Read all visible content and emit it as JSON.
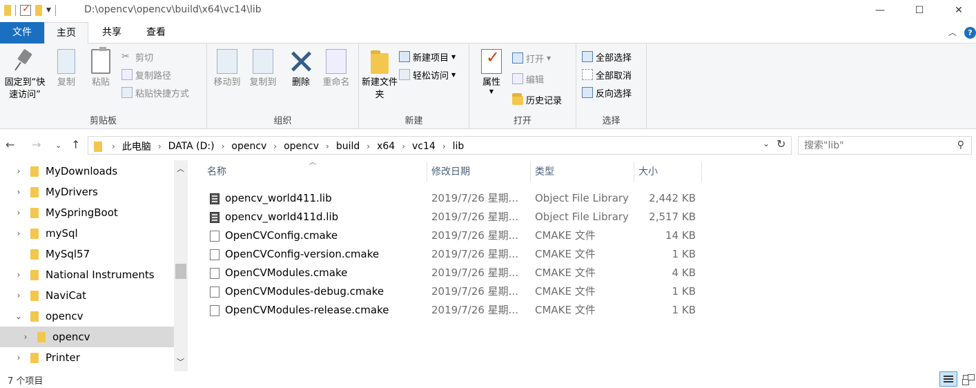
{
  "window": {
    "path": "D:\\opencv\\opencv\\build\\x64\\vc14\\lib",
    "minimize": "—",
    "maximize": "☐",
    "close": "✕"
  },
  "tabs": [
    "文件",
    "主页",
    "共享",
    "查看"
  ],
  "ribbon": {
    "clipboard": {
      "label": "剪贴板",
      "pin": "固定到“快速访问”",
      "copy": "复制",
      "paste": "粘贴",
      "cut": "剪切",
      "copy_path": "复制路径",
      "paste_shortcut": "粘贴快捷方式"
    },
    "organize": {
      "label": "组织",
      "move_to": "移动到",
      "copy_to": "复制到",
      "delete": "删除",
      "rename": "重命名"
    },
    "new": {
      "label": "新建",
      "new_folder": "新建文件夹",
      "new_item": "新建项目",
      "easy_access": "轻松访问"
    },
    "open": {
      "label": "打开",
      "properties": "属性",
      "open": "打开",
      "edit": "编辑",
      "history": "历史记录"
    },
    "select": {
      "label": "选择",
      "select_all": "全部选择",
      "select_none": "全部取消",
      "invert": "反向选择"
    }
  },
  "address": {
    "crumbs": [
      "此电脑",
      "DATA (D:)",
      "opencv",
      "opencv",
      "build",
      "x64",
      "vc14",
      "lib"
    ],
    "search_placeholder": "搜索\"lib\""
  },
  "nav": {
    "items": [
      {
        "label": "MyDownloads",
        "chevron": "›"
      },
      {
        "label": "MyDrivers",
        "chevron": "›"
      },
      {
        "label": "MySpringBoot",
        "chevron": "›"
      },
      {
        "label": "mySql",
        "chevron": "›"
      },
      {
        "label": "MySql57",
        "chevron": ""
      },
      {
        "label": "National Instruments",
        "chevron": "›"
      },
      {
        "label": "NaviCat",
        "chevron": "›"
      },
      {
        "label": "opencv",
        "chevron": "⌄"
      },
      {
        "label": "opencv",
        "chevron": "›"
      },
      {
        "label": "Printer",
        "chevron": "›"
      }
    ]
  },
  "columns": [
    "名称",
    "修改日期",
    "类型",
    "大小"
  ],
  "files": [
    {
      "name": "opencv_world411.lib",
      "date": "2019/7/26 星期...",
      "type": "Object File Library",
      "size": "2,442 KB",
      "icon": "lib"
    },
    {
      "name": "opencv_world411d.lib",
      "date": "2019/7/26 星期...",
      "type": "Object File Library",
      "size": "2,517 KB",
      "icon": "lib"
    },
    {
      "name": "OpenCVConfig.cmake",
      "date": "2019/7/26 星期...",
      "type": "CMAKE 文件",
      "size": "14 KB",
      "icon": "cmake"
    },
    {
      "name": "OpenCVConfig-version.cmake",
      "date": "2019/7/26 星期...",
      "type": "CMAKE 文件",
      "size": "1 KB",
      "icon": "cmake"
    },
    {
      "name": "OpenCVModules.cmake",
      "date": "2019/7/26 星期...",
      "type": "CMAKE 文件",
      "size": "4 KB",
      "icon": "cmake"
    },
    {
      "name": "OpenCVModules-debug.cmake",
      "date": "2019/7/26 星期...",
      "type": "CMAKE 文件",
      "size": "1 KB",
      "icon": "cmake"
    },
    {
      "name": "OpenCVModules-release.cmake",
      "date": "2019/7/26 星期...",
      "type": "CMAKE 文件",
      "size": "1 KB",
      "icon": "cmake"
    }
  ],
  "status": {
    "count": "7 个项目"
  }
}
